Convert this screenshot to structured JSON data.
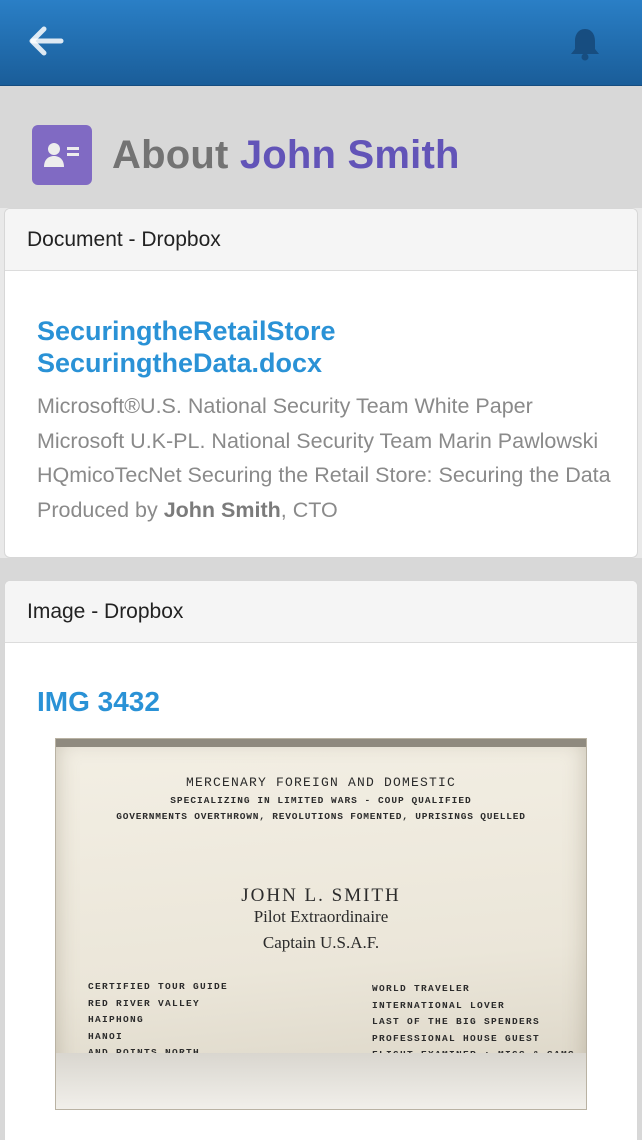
{
  "topbar": {
    "back_icon": "back-arrow-icon",
    "bell_icon": "bell-icon",
    "color": "#1f6db0"
  },
  "header": {
    "icon": "contact-card-icon",
    "prefix": "About",
    "name": "John Smith",
    "accent": "#6a5bc6"
  },
  "document_card": {
    "header": "Document - Dropbox",
    "title_line1": "SecuringtheRetailStore",
    "title_line2": "SecuringtheData.docx",
    "snippet_before": " Microsoft®U.S. National Security Team White Paper Microsoft U.K-PL. National Security Team Marin Pawlowski HQmicoTecNet Securing the Retail Store: Securing the Data Produced by ",
    "snippet_bold": "John Smith",
    "snippet_after": ", CTO"
  },
  "image_card": {
    "header": "Image - Dropbox",
    "title": "IMG 3432",
    "card_text": {
      "line1": "MERCENARY FOREIGN AND DOMESTIC",
      "line2": "SPECIALIZING IN LIMITED WARS - COUP QUALIFIED",
      "line3": "GOVERNMENTS OVERTHROWN, REVOLUTIONS FOMENTED, UPRISINGS QUELLED",
      "name": "JOHN L. SMITH",
      "role": "Pilot Extraordinaire",
      "rank": "Captain    U.S.A.F.",
      "left_lines": [
        "CERTIFIED TOUR GUIDE",
        "RED RIVER VALLEY",
        "HAIPHONG",
        "HANOI",
        "AND POINTS NORTH"
      ],
      "right_lines": [
        "WORLD TRAVELER",
        "INTERNATIONAL LOVER",
        "LAST OF THE BIG SPENDERS",
        "PROFESSIONAL HOUSE GUEST",
        "FLIGHT EXAMINER ; MIGS & SAMS"
      ]
    }
  }
}
